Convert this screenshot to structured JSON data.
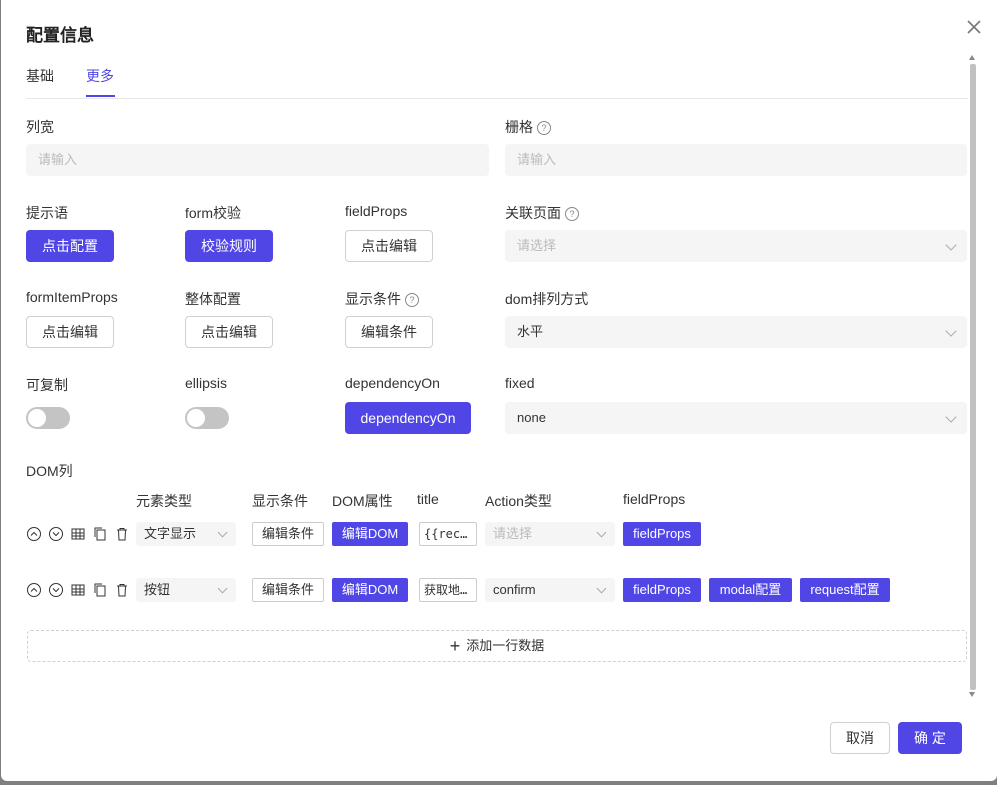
{
  "dialog": {
    "title": "配置信息",
    "tabs": [
      "基础",
      "更多"
    ],
    "active_tab": "更多"
  },
  "fields": {
    "col_width": {
      "label": "列宽",
      "placeholder": "请输入"
    },
    "grid": {
      "label": "栅格",
      "placeholder": "请输入"
    },
    "tip": {
      "label": "提示语",
      "button": "点击配置"
    },
    "form_validate": {
      "label": "form校验",
      "button": "校验规则"
    },
    "field_props": {
      "label": "fieldProps",
      "button": "点击编辑"
    },
    "related_page": {
      "label": "关联页面",
      "placeholder": "请选择"
    },
    "form_item_props": {
      "label": "formItemProps",
      "button": "点击编辑"
    },
    "overall_config": {
      "label": "整体配置",
      "button": "点击编辑"
    },
    "show_condition": {
      "label": "显示条件",
      "button": "编辑条件"
    },
    "dom_layout": {
      "label": "dom排列方式",
      "value": "水平"
    },
    "copyable": {
      "label": "可复制",
      "on": false
    },
    "ellipsis": {
      "label": "ellipsis",
      "on": false
    },
    "dependency_on": {
      "label": "dependencyOn",
      "button": "dependencyOn"
    },
    "fixed": {
      "label": "fixed",
      "value": "none"
    }
  },
  "dom_list": {
    "label": "DOM列",
    "headers": [
      "元素类型",
      "显示条件",
      "DOM属性",
      "title",
      "Action类型",
      "fieldProps"
    ],
    "rows": [
      {
        "element_type": "文字显示",
        "condition_btn": "编辑条件",
        "dom_btn": "编辑DOM",
        "title": "{{rec…",
        "action": "请选择",
        "action_placeholder": true,
        "props": [
          "fieldProps"
        ]
      },
      {
        "element_type": "按钮",
        "condition_btn": "编辑条件",
        "dom_btn": "编辑DOM",
        "title": "获取地…",
        "action": "confirm",
        "action_placeholder": false,
        "props": [
          "fieldProps",
          "modal配置",
          "request配置"
        ]
      }
    ],
    "add_row": "添加一行数据"
  },
  "footer": {
    "cancel": "取消",
    "ok": "确 定"
  },
  "colors": {
    "primary": "#4f46e5",
    "input_bg": "#f5f5f5"
  }
}
